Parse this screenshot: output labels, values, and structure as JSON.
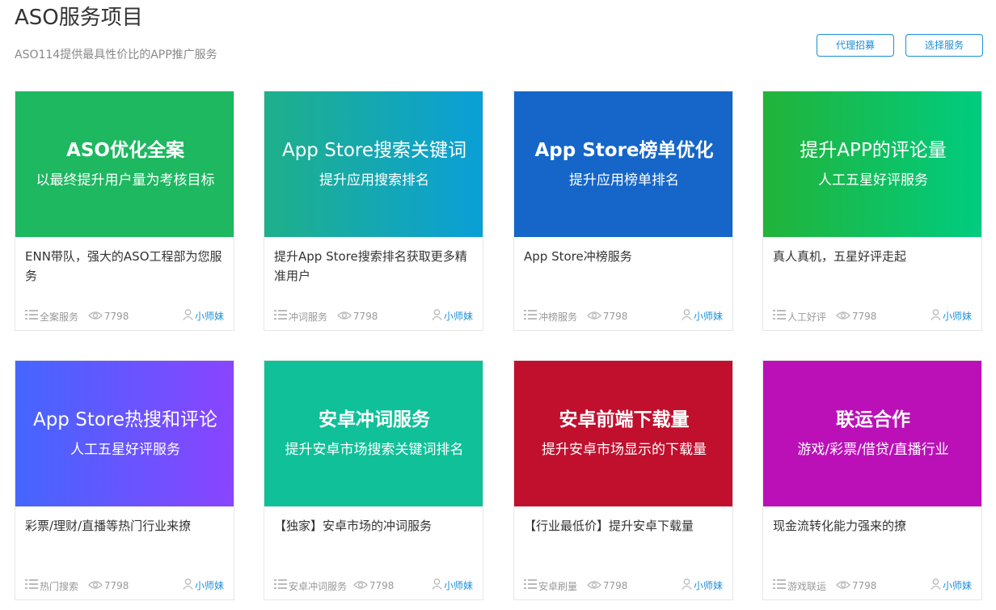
{
  "header": {
    "title": "ASO服务项目",
    "subtitle": "ASO114提供最具性价比的APP推广服务",
    "agent_button": "代理招募",
    "select_button": "选择服务"
  },
  "colors": {
    "accent": "#1a8fd8",
    "card1": [
      "#1db860",
      "#1db860"
    ],
    "card2": [
      "#1fb08a",
      "#0a9fd8"
    ],
    "card3": [
      "#1566c8",
      "#1566c8"
    ],
    "card4": [
      "#22b33a",
      "#00cc80"
    ],
    "card5": [
      "#4466ff",
      "#8a44ff"
    ],
    "card6": [
      "#10c098",
      "#10c098"
    ],
    "card7": [
      "#c0102e",
      "#c0102e"
    ],
    "card8": [
      "#bb10b8",
      "#bb10b8"
    ]
  },
  "cards": [
    {
      "title": "ASO优化全案",
      "subtitle": "以最终提升用户量为考核目标",
      "desc": "ENN带队，强大的ASO工程部为您服务",
      "category": "全案服务",
      "views": "7798",
      "author": "小师妹"
    },
    {
      "title": "App Store搜索关键词",
      "subtitle": "提升应用搜索排名",
      "desc": "提升App Store搜索排名获取更多精准用户",
      "category": "冲词服务",
      "views": "7798",
      "author": "小师妹"
    },
    {
      "title": "App Store榜单优化",
      "subtitle": "提升应用榜单排名",
      "desc": "App Store冲榜服务",
      "category": "冲榜服务",
      "views": "7798",
      "author": "小师妹"
    },
    {
      "title": "提升APP的评论量",
      "subtitle": "人工五星好评服务",
      "desc": "真人真机，五星好评走起",
      "category": "人工好评",
      "views": "7798",
      "author": "小师妹"
    },
    {
      "title": "App Store热搜和评论",
      "subtitle": "人工五星好评服务",
      "desc": "彩票/理财/直播等热门行业来撩",
      "category": "热门搜索",
      "views": "7798",
      "author": "小师妹"
    },
    {
      "title": "安卓冲词服务",
      "subtitle": "提升安卓市场搜索关键词排名",
      "desc": "【独家】安卓市场的冲词服务",
      "category": "安卓冲词服务",
      "views": "7798",
      "author": "小师妹"
    },
    {
      "title": "安卓前端下载量",
      "subtitle": "提升安卓市场显示的下载量",
      "desc": "【行业最低价】提升安卓下载量",
      "category": "安卓刷量",
      "views": "7798",
      "author": "小师妹"
    },
    {
      "title": "联运合作",
      "subtitle": "游戏/彩票/借贷/直播行业",
      "desc": "现金流转化能力强来的撩",
      "category": "游戏联运",
      "views": "7798",
      "author": "小师妹"
    }
  ]
}
